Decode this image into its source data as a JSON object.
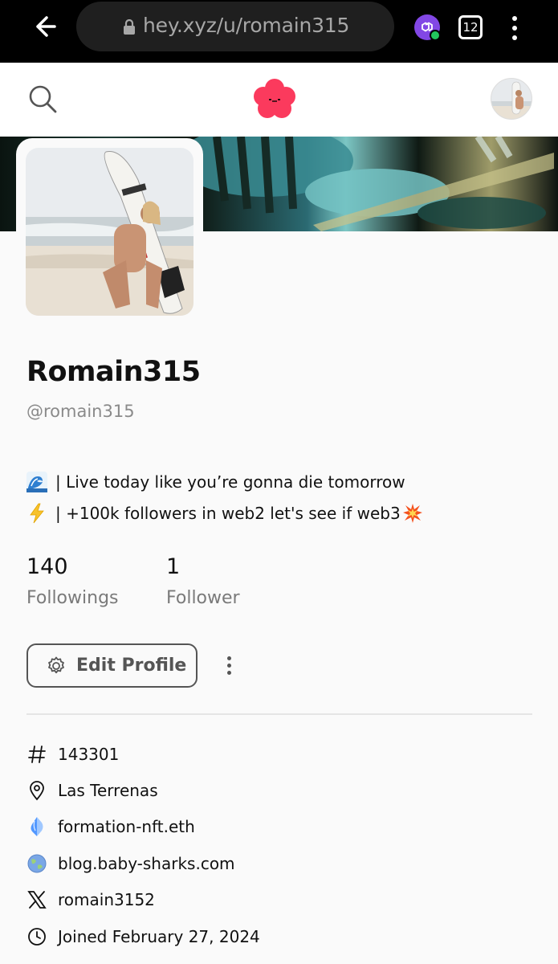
{
  "browser": {
    "url": "hey.xyz/u/romain315",
    "tab_count": "12"
  },
  "profile": {
    "display_name": "Romain315",
    "handle": "@romain315",
    "bio": [
      {
        "emoji": "wave",
        "text": " | Live today like you’re gonna die tomorrow"
      },
      {
        "emoji": "lightning",
        "text": " | +100k followers in web2 let's see if web3",
        "trailing_emoji": "collision"
      }
    ],
    "stats": [
      {
        "value": "140",
        "label": "Followings"
      },
      {
        "value": "1",
        "label": "Follower"
      }
    ],
    "edit_label": "Edit Profile",
    "details": [
      {
        "icon": "hash-icon",
        "text": "143301"
      },
      {
        "icon": "location-pin-icon",
        "text": "Las Terrenas"
      },
      {
        "icon": "ens-icon",
        "text": "formation-nft.eth"
      },
      {
        "icon": "globe-icon",
        "text": "blog.baby-sharks.com"
      },
      {
        "icon": "x-icon",
        "text": "romain3152"
      },
      {
        "icon": "clock-icon",
        "text": "Joined February 27, 2024"
      }
    ]
  },
  "colors": {
    "brand": "#fb3a5d",
    "muted_text": "#8a8a8a"
  }
}
